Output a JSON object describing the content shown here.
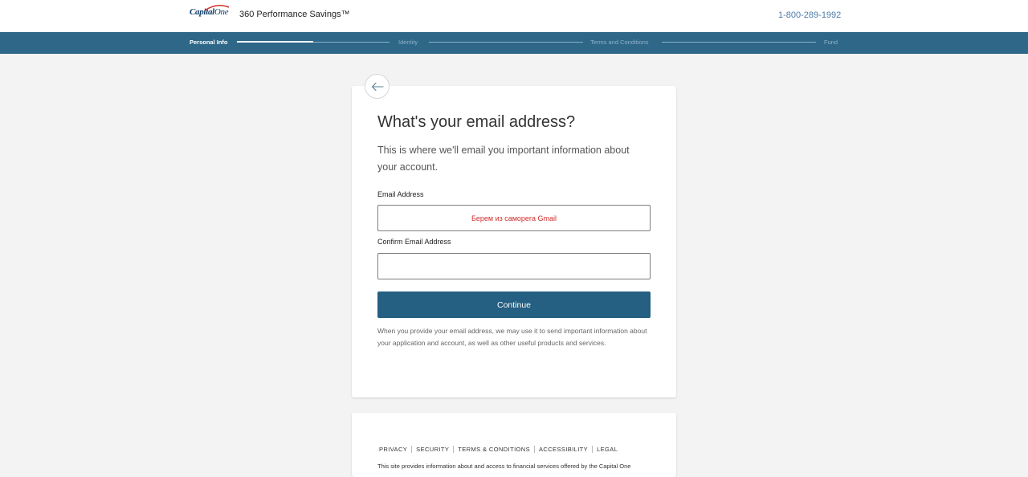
{
  "header": {
    "logo_text": "Capital",
    "logo_text_2": "One",
    "product_title": "360 Performance Savings™",
    "phone": "1-800-289-1992"
  },
  "progress": {
    "steps": [
      {
        "label": "Personal Info",
        "active": true
      },
      {
        "label": "Identity",
        "active": false
      },
      {
        "label": "Terms and Conditions",
        "active": false
      },
      {
        "label": "Fund",
        "active": false
      }
    ],
    "current_step_fraction": 0.5
  },
  "form": {
    "heading": "What's your email address?",
    "subtext": "This is where we'll email you important information about your account.",
    "email_label": "Email Address",
    "email_value": "Берем из саморега Gmail",
    "confirm_label": "Confirm Email Address",
    "confirm_value": "",
    "continue_label": "Continue",
    "note": "When you provide your email address, we may use it to send important information about your application and account, as well as other useful products and services."
  },
  "footer": {
    "links": [
      "PRIVACY",
      "SECURITY",
      "TERMS & CONDITIONS",
      "ACCESSIBILITY",
      "LEGAL"
    ],
    "text": "This site provides information about and access to financial services offered by the Capital One"
  },
  "icons": {
    "back": "arrow-left-icon",
    "logo_swoosh": "swoosh-icon"
  },
  "colors": {
    "progress_bg": "#2e6788",
    "button": "#255f82",
    "phone": "#4b7aa8",
    "email_value_text": "#d12c2c"
  }
}
